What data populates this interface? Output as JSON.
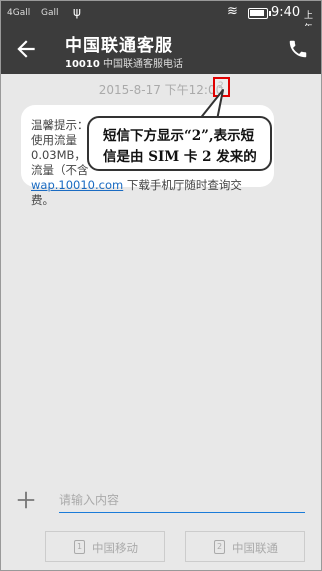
{
  "status_bar": {
    "signal1": "4Gall",
    "signal2": "Gall",
    "time": "9:40",
    "ampm": "上午"
  },
  "app_bar": {
    "title": "中国联通客服",
    "number": "10010",
    "subtitle": "中国联通客服电话"
  },
  "conversation": {
    "timestamp": "2015-8-17 下午12:00",
    "sim_marker": "2",
    "message_lines": [
      "温馨提示：",
      "使用流量",
      "0.03MB，",
      "流量（不含",
      "下载手机厅随时查询交",
      "费。"
    ],
    "link_text": "wap.10010.com"
  },
  "annotation": {
    "line1": "短信下方显示“2”,表示短",
    "line2": "信是由 SIM 卡 2 发来的"
  },
  "composer": {
    "placeholder": "请输入内容",
    "sim1_label": "中国移动",
    "sim1_number": "1",
    "sim2_label": "中国联通",
    "sim2_number": "2"
  },
  "colors": {
    "app_bar": "#3c3c3c",
    "accent": "#1a7bd8",
    "link": "#1a6bc2",
    "highlight": "#e00000"
  }
}
